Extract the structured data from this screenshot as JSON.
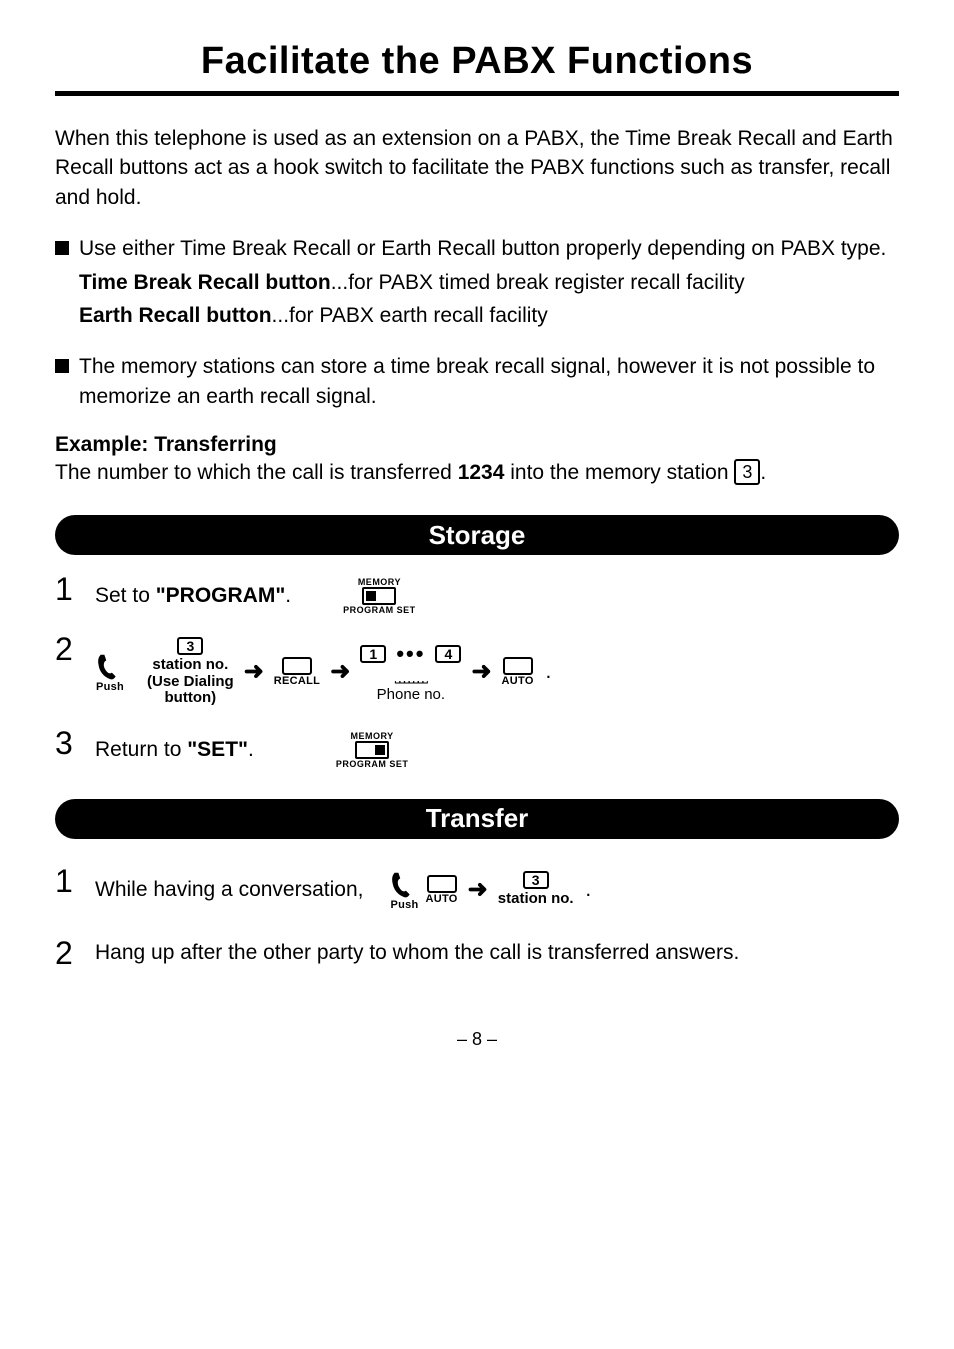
{
  "title": "Facilitate the PABX Functions",
  "intro": "When this telephone is used as an extension on a PABX, the Time Break Recall and Earth Recall buttons act as a hook switch to facilitate the PABX functions such as transfer, recall and hold.",
  "bullet1": {
    "lead": "Use either Time Break Recall or Earth Recall button properly depending on PABX type.",
    "tb_label": "Time Break Recall button",
    "tb_desc": "...for PABX timed break register recall facility",
    "er_label": "Earth Recall button",
    "er_desc": "...for PABX earth recall facility"
  },
  "bullet2": "The memory stations can store a time break recall signal, however it is not possible to memorize an earth recall signal.",
  "example": {
    "heading": "Example:  Transferring",
    "line_a": "The number to which the call is transferred ",
    "num": "1234",
    "line_b": " into the memory station ",
    "station": "3",
    "line_c": "."
  },
  "storage": {
    "bar": "Storage",
    "s1_a": "Set to ",
    "s1_b": "\"PROGRAM\"",
    "s1_c": ".",
    "memory_lbl": "MEMORY",
    "progset_lbl": "PROGRAM SET",
    "push_lbl": "Push",
    "station_lbl": "station no.",
    "use_dial_a": "Use Dialing",
    "use_dial_b": "button",
    "recall_lbl": "RECALL",
    "key3": "3",
    "key1": "1",
    "key4": "4",
    "auto_lbl": "AUTO",
    "phone_lbl": "Phone no.",
    "s3_a": "Return to ",
    "s3_b": "\"SET\"",
    "s3_c": "."
  },
  "transfer": {
    "bar": "Transfer",
    "s1": "While having a conversation,",
    "push_lbl": "Push",
    "auto_lbl": "AUTO",
    "key3": "3",
    "station_lbl": "station no.",
    "s2": "Hang up after the other party to whom the call is transferred answers."
  },
  "page_no": "– 8 –",
  "nums": {
    "n1": "1",
    "n2": "2",
    "n3": "3"
  }
}
